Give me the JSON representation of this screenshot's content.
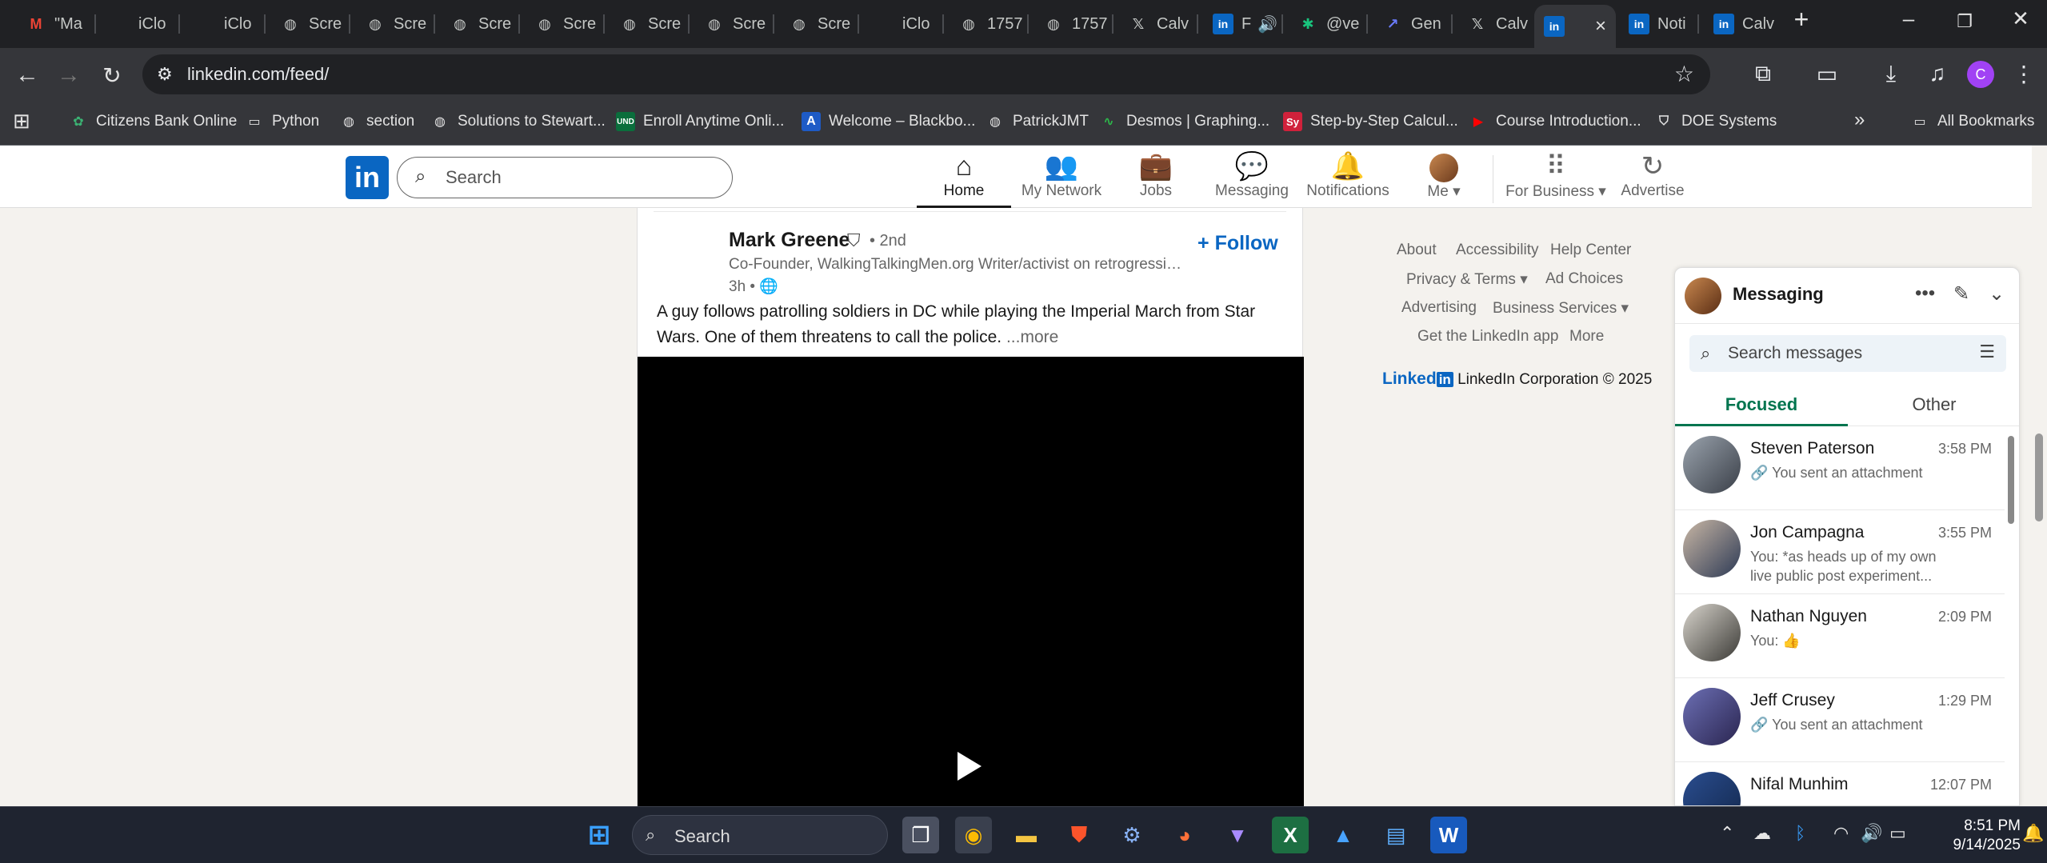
{
  "browser": {
    "tabs": [
      {
        "label": "\"Ma",
        "icon": "gmail-icon"
      },
      {
        "label": "iClo",
        "icon": "apple-icon"
      },
      {
        "label": "iClo",
        "icon": "apple-icon"
      },
      {
        "label": "Scre",
        "icon": "globe-icon"
      },
      {
        "label": "Scre",
        "icon": "globe-icon"
      },
      {
        "label": "Scre",
        "icon": "globe-icon"
      },
      {
        "label": "Scre",
        "icon": "globe-icon"
      },
      {
        "label": "Scre",
        "icon": "globe-icon"
      },
      {
        "label": "Scre",
        "icon": "globe-icon"
      },
      {
        "label": "Scre",
        "icon": "globe-icon"
      },
      {
        "label": "iClo",
        "icon": "apple-icon"
      },
      {
        "label": "1757",
        "icon": "globe-icon"
      },
      {
        "label": "1757",
        "icon": "globe-icon"
      },
      {
        "label": "Calv",
        "icon": "x-icon"
      },
      {
        "label": "F",
        "icon": "linkedin-icon"
      },
      {
        "label": "@ve",
        "icon": "asterisk-icon"
      },
      {
        "label": "Gen",
        "icon": "arrow-icon"
      },
      {
        "label": "Calv",
        "icon": "x-icon"
      },
      {
        "label": "",
        "icon": "linkedin-icon"
      },
      {
        "label": "Noti",
        "icon": "linkedin-icon"
      },
      {
        "label": "Calv",
        "icon": "linkedin-icon"
      }
    ],
    "url": "linkedin.com/feed/",
    "bookmarks": [
      {
        "label": "Citizens Bank Online"
      },
      {
        "label": "Python"
      },
      {
        "label": "section"
      },
      {
        "label": "Solutions to Stewart..."
      },
      {
        "label": "Enroll Anytime Onli..."
      },
      {
        "label": "Welcome – Blackbo..."
      },
      {
        "label": "PatrickJMT"
      },
      {
        "label": "Desmos | Graphing..."
      },
      {
        "label": "Step-by-Step Calcul..."
      },
      {
        "label": "Course Introduction..."
      },
      {
        "label": "DOE Systems"
      }
    ],
    "all_bookmarks": "All Bookmarks",
    "profile_initial": "C"
  },
  "linkedin": {
    "search_placeholder": "Search",
    "nav": [
      {
        "label": "Home"
      },
      {
        "label": "My Network"
      },
      {
        "label": "Jobs"
      },
      {
        "label": "Messaging"
      },
      {
        "label": "Notifications"
      },
      {
        "label": "Me"
      },
      {
        "label": "For Business"
      },
      {
        "label": "Advertise"
      }
    ],
    "post": {
      "author": "Mark Greene",
      "degree": "• 2nd",
      "headline": "Co-Founder, WalkingTalkingMen.org Writer/activist on retrogressive M...",
      "time": "3h •",
      "follow": "Follow",
      "text": "A guy follows patrolling soldiers in DC while playing the Imperial March from Star Wars. One of them threatens to call the police.",
      "more": "...more"
    },
    "footer": {
      "about": "About",
      "accessibility": "Accessibility",
      "help": "Help Center",
      "privacy": "Privacy & Terms",
      "ad_choices": "Ad Choices",
      "advertising": "Advertising",
      "business": "Business Services",
      "get_app": "Get the LinkedIn app",
      "more": "More",
      "brand_logo": "Linked",
      "copyright": "LinkedIn Corporation © 2025"
    },
    "messaging": {
      "title": "Messaging",
      "search_placeholder": "Search messages",
      "tabs": [
        "Focused",
        "Other"
      ],
      "conversations": [
        {
          "name": "Steven Paterson",
          "time": "3:58 PM",
          "preview": "🔗 You sent an attachment"
        },
        {
          "name": "Jon Campagna",
          "time": "3:55 PM",
          "preview": "You: *as heads up of my own live public post experiment..."
        },
        {
          "name": "Nathan Nguyen",
          "time": "2:09 PM",
          "preview": "You: 👍"
        },
        {
          "name": "Jeff Crusey",
          "time": "1:29 PM",
          "preview": "🔗 You sent an attachment"
        },
        {
          "name": "Nifal Munhim",
          "time": "12:07 PM",
          "preview": ""
        }
      ]
    }
  },
  "taskbar": {
    "search_label": "Search",
    "time": "8:51 PM",
    "date": "9/14/2025"
  }
}
